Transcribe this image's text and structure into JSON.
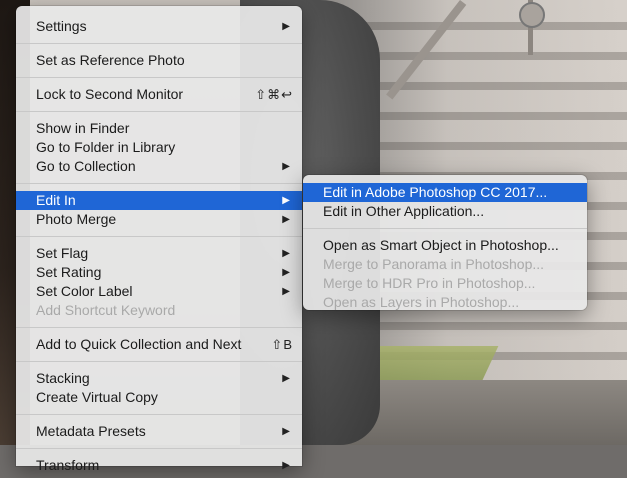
{
  "menu": {
    "groups": [
      [
        {
          "label": "Settings",
          "submenu": true
        }
      ],
      [
        {
          "label": "Set as Reference Photo"
        }
      ],
      [
        {
          "label": "Lock to Second Monitor",
          "shortcut": "⇧⌘↩"
        }
      ],
      [
        {
          "label": "Show in Finder"
        },
        {
          "label": "Go to Folder in Library"
        },
        {
          "label": "Go to Collection",
          "submenu": true
        }
      ],
      [
        {
          "label": "Edit In",
          "submenu": true,
          "active": true
        },
        {
          "label": "Photo Merge",
          "submenu": true
        }
      ],
      [
        {
          "label": "Set Flag",
          "submenu": true
        },
        {
          "label": "Set Rating",
          "submenu": true
        },
        {
          "label": "Set Color Label",
          "submenu": true
        },
        {
          "label": "Add Shortcut Keyword",
          "disabled": true
        }
      ],
      [
        {
          "label": "Add to Quick Collection and Next",
          "shortcut": "⇧B"
        }
      ],
      [
        {
          "label": "Stacking",
          "submenu": true
        },
        {
          "label": "Create Virtual Copy"
        }
      ],
      [
        {
          "label": "Metadata Presets",
          "submenu": true
        }
      ],
      [
        {
          "label": "Transform",
          "submenu": true
        }
      ]
    ]
  },
  "submenu": {
    "groups": [
      [
        {
          "label": "Edit in Adobe Photoshop CC 2017...",
          "active": true
        },
        {
          "label": "Edit in Other Application..."
        }
      ],
      [
        {
          "label": "Open as Smart Object in Photoshop..."
        },
        {
          "label": "Merge to Panorama in Photoshop...",
          "disabled": true
        },
        {
          "label": "Merge to HDR Pro in Photoshop...",
          "disabled": true
        },
        {
          "label": "Open as Layers in Photoshop...",
          "disabled": true
        }
      ]
    ]
  },
  "icons": {
    "submenu_arrow": "▶"
  },
  "colors": {
    "highlight": "#1f66d6",
    "menu_bg": "#e8e8e8",
    "disabled_text": "#a9a9a9"
  }
}
